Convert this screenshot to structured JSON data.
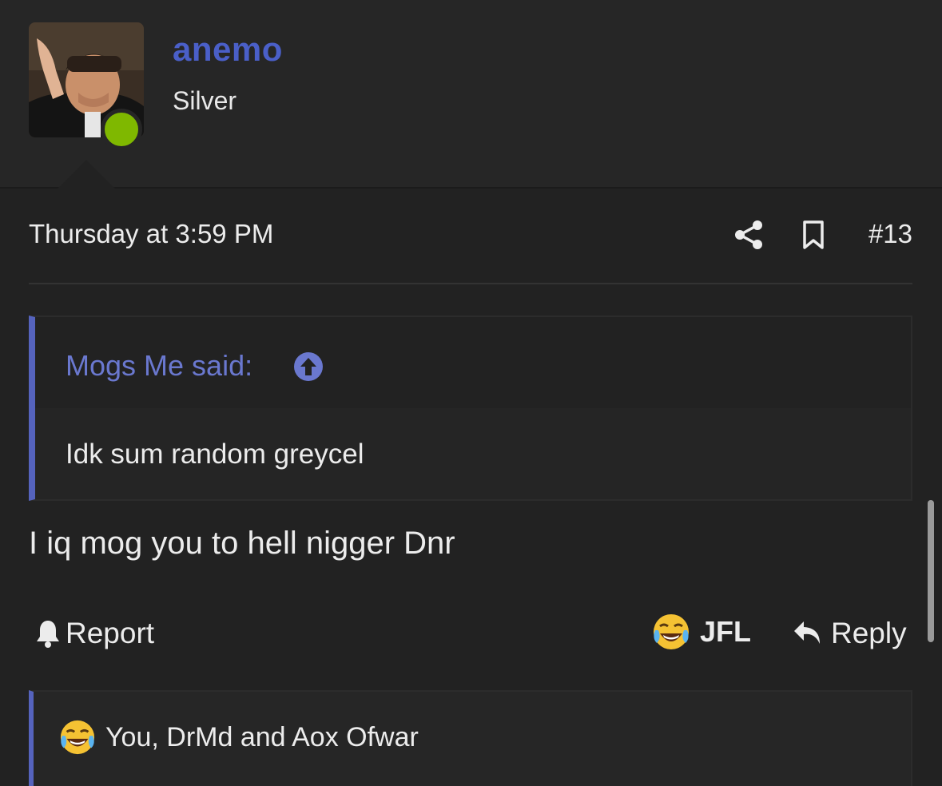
{
  "user": {
    "name": "anemo",
    "title": "Silver",
    "online": true,
    "status_color": "#7fb800"
  },
  "post": {
    "date": "Thursday at 3:59 PM",
    "number": "#13",
    "share_icon": "share-icon",
    "bookmark_icon": "bookmark-icon",
    "body": "I iq mog you to hell nigger Dnr"
  },
  "quote": {
    "attribution": "Mogs Me said:",
    "text": "Idk sum random greycel",
    "accent_color": "#5563bd"
  },
  "actions": {
    "report_label": "Report",
    "reaction_label": "JFL",
    "reply_label": "Reply"
  },
  "reactions": {
    "summary": "You, DrMd and Aox Ofwar",
    "emoji": "laughing-crying-emoji"
  }
}
